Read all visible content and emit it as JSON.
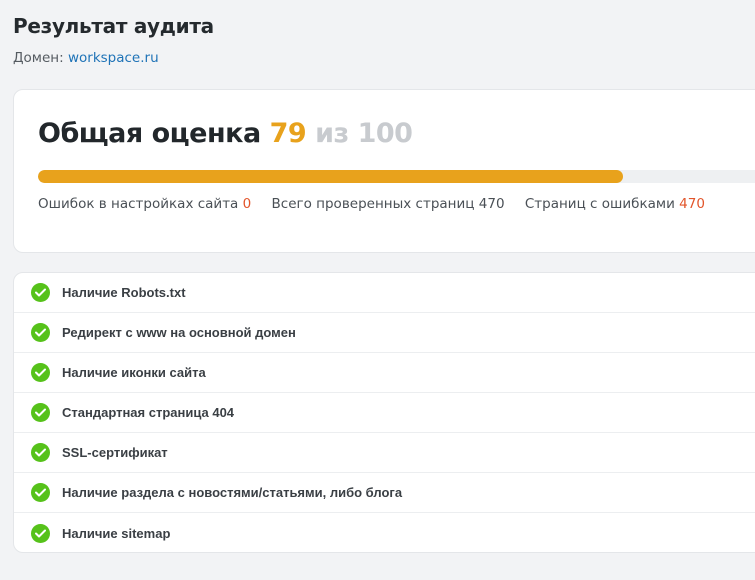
{
  "header": {
    "title": "Результат аудита",
    "domain_label": "Домен:",
    "domain_value": "workspace.ru"
  },
  "score": {
    "heading": "Общая оценка",
    "value": "79",
    "of_word": "из",
    "max": "100",
    "progress_fraction": 0.79,
    "progress_color": "#e8a21c"
  },
  "stats": {
    "settings_errors_label": "Ошибок в настройках сайта",
    "settings_errors_value": "0",
    "pages_checked_label": "Всего проверенных страниц",
    "pages_checked_value": "470",
    "pages_with_errors_label": "Страниц с ошибками",
    "pages_with_errors_value": "470"
  },
  "checks": [
    {
      "label": "Наличие Robots.txt",
      "status": "passed",
      "icon": "check-circle-icon"
    },
    {
      "label": "Редирект с www на основной домен",
      "status": "passed",
      "icon": "check-circle-icon"
    },
    {
      "label": "Наличие иконки сайта",
      "status": "passed",
      "icon": "check-circle-icon"
    },
    {
      "label": "Стандартная страница 404",
      "status": "passed",
      "icon": "check-circle-icon"
    },
    {
      "label": "SSL-сертификат",
      "status": "passed",
      "icon": "check-circle-icon"
    },
    {
      "label": "Наличие раздела с новостями/статьями, либо блога",
      "status": "passed",
      "icon": "check-circle-icon"
    },
    {
      "label": "Наличие sitemap",
      "status": "passed",
      "icon": "check-circle-icon"
    }
  ],
  "colors": {
    "accent": "#e8a21c",
    "success": "#56c21a",
    "error": "#e2552b",
    "link": "#1f73b7"
  }
}
